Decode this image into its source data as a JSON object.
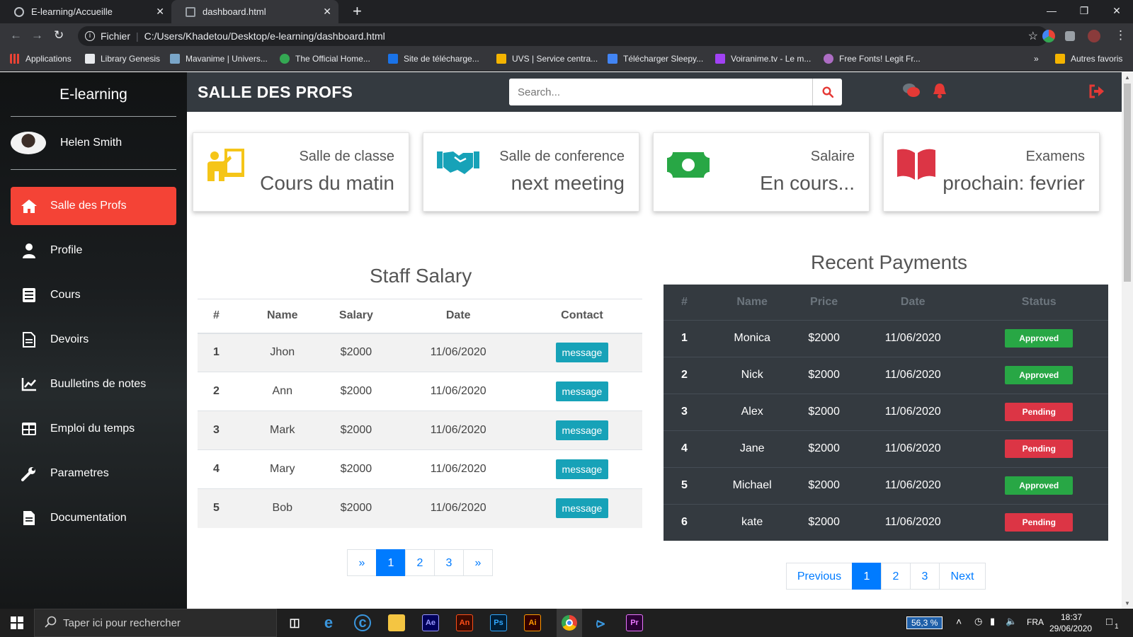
{
  "browser": {
    "tabs": [
      {
        "title": "E-learning/Accueille",
        "close": "✕"
      },
      {
        "title": "dashboard.html",
        "close": "✕"
      }
    ],
    "new_tab": "+",
    "address_scheme": "Fichier",
    "address_url": "C:/Users/Khadetou/Desktop/e-learning/dashboard.html",
    "bookmarks": [
      {
        "label": "Applications",
        "color": "#e94235"
      },
      {
        "label": "Library Genesis",
        "color": "#e8eaed"
      },
      {
        "label": "Mavanime | Univers...",
        "color": "#7aa6c9"
      },
      {
        "label": "The Official Home...",
        "color": "#34a853"
      },
      {
        "label": "Site de télécharge...",
        "color": "#1a73e8"
      },
      {
        "label": "UVS | Service centra...",
        "color": "#f4b400"
      },
      {
        "label": "Télécharger Sleepy...",
        "color": "#4285f4"
      },
      {
        "label": "Voiranime.tv - Le m...",
        "color": "#a142f4"
      },
      {
        "label": "Free Fonts! Legit Fr...",
        "color": "#ad6dc4"
      }
    ],
    "bookmarks_more": "»",
    "other_bookmarks": "Autres favoris"
  },
  "sidebar": {
    "brand": "E-learning",
    "user_name": "Helen Smith",
    "items": [
      {
        "label": "Salle des Profs",
        "icon": "home-icon",
        "active": true
      },
      {
        "label": "Profile",
        "icon": "user-icon"
      },
      {
        "label": "Cours",
        "icon": "book-icon"
      },
      {
        "label": "Devoirs",
        "icon": "file-icon"
      },
      {
        "label": "Buulletins de notes",
        "icon": "chart-line-icon"
      },
      {
        "label": "Emploi du temps",
        "icon": "table-icon"
      },
      {
        "label": "Parametres",
        "icon": "wrench-icon"
      },
      {
        "label": "Documentation",
        "icon": "document-icon"
      }
    ]
  },
  "topbar": {
    "title": "SALLE DES PROFS",
    "search_placeholder": "Search..."
  },
  "cards": [
    {
      "label": "Salle de classe",
      "value": "Cours du matin",
      "icon": "chalkboard-teacher-icon",
      "color": "#f5c518"
    },
    {
      "label": "Salle de conference",
      "value": "next meeting",
      "icon": "handshake-icon",
      "color": "#17a2b8"
    },
    {
      "label": "Salaire",
      "value": "En cours...",
      "icon": "money-bill-icon",
      "color": "#28a745"
    },
    {
      "label": "Examens",
      "value": "prochain: fevrier",
      "icon": "open-book-icon",
      "color": "#dc3545"
    }
  ],
  "staff_salary": {
    "title": "Staff Salary",
    "columns": [
      "#",
      "Name",
      "Salary",
      "Date",
      "Contact"
    ],
    "button_label": "message",
    "rows": [
      {
        "num": "1",
        "name": "Jhon",
        "salary": "$2000",
        "date": "11/06/2020"
      },
      {
        "num": "2",
        "name": "Ann",
        "salary": "$2000",
        "date": "11/06/2020"
      },
      {
        "num": "3",
        "name": "Mark",
        "salary": "$2000",
        "date": "11/06/2020"
      },
      {
        "num": "4",
        "name": "Mary",
        "salary": "$2000",
        "date": "11/06/2020"
      },
      {
        "num": "5",
        "name": "Bob",
        "salary": "$2000",
        "date": "11/06/2020"
      }
    ],
    "pagination": [
      "»",
      "1",
      "2",
      "3",
      "»"
    ]
  },
  "recent_payments": {
    "title": "Recent Payments",
    "columns": [
      "#",
      "Name",
      "Price",
      "Date",
      "Status"
    ],
    "rows": [
      {
        "num": "1",
        "name": "Monica",
        "price": "$2000",
        "date": "11/06/2020",
        "status": "Approved"
      },
      {
        "num": "2",
        "name": "Nick",
        "price": "$2000",
        "date": "11/06/2020",
        "status": "Approved"
      },
      {
        "num": "3",
        "name": "Alex",
        "price": "$2000",
        "date": "11/06/2020",
        "status": "Pending"
      },
      {
        "num": "4",
        "name": "Jane",
        "price": "$2000",
        "date": "11/06/2020",
        "status": "Pending"
      },
      {
        "num": "5",
        "name": "Michael",
        "price": "$2000",
        "date": "11/06/2020",
        "status": "Approved"
      },
      {
        "num": "6",
        "name": "kate",
        "price": "$2000",
        "date": "11/06/2020",
        "status": "Pending"
      }
    ],
    "pagination": [
      "Previous",
      "1",
      "2",
      "3",
      "Next"
    ]
  },
  "taskbar": {
    "search_placeholder": "Taper ici pour rechercher",
    "apps": [
      {
        "label": "Ae",
        "color": "#9999ff",
        "bg": "#00005b"
      },
      {
        "label": "An",
        "color": "#ff4f19",
        "bg": "#3a0a00"
      },
      {
        "label": "Ps",
        "color": "#31a8ff",
        "bg": "#001e36"
      },
      {
        "label": "Ai",
        "color": "#ff9a00",
        "bg": "#330000"
      },
      {
        "label": "Pr",
        "color": "#ea77ff",
        "bg": "#2a0034"
      }
    ],
    "battery": "56,3 %",
    "language": "FRA",
    "time": "18:37",
    "date": "29/06/2020",
    "notifications": "1"
  }
}
